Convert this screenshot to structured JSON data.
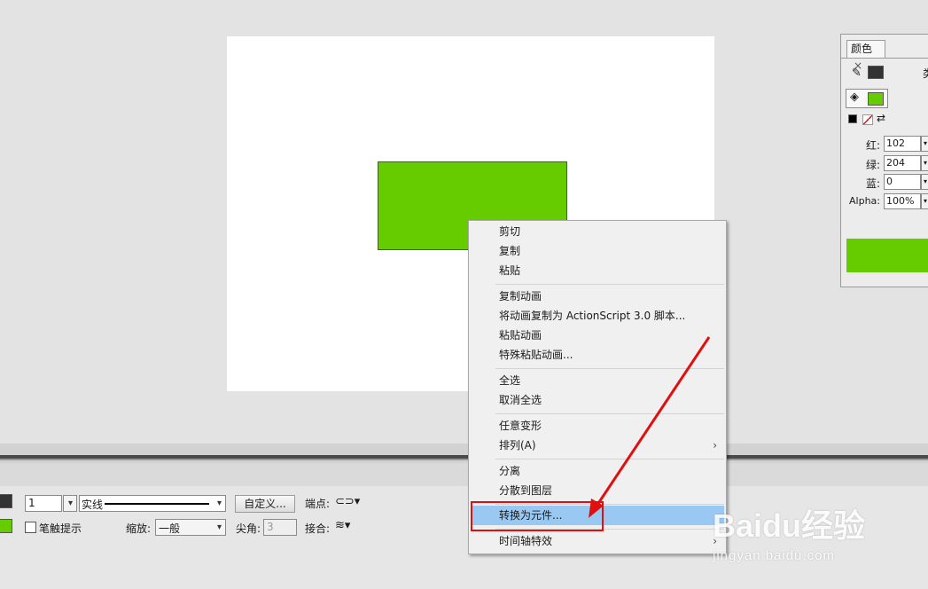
{
  "colors": {
    "shape_fill": "#66cc00",
    "menu_highlight": "#99c9f3",
    "annotation_red": "#e01010"
  },
  "context_menu": {
    "items": [
      {
        "label": "剪切"
      },
      {
        "label": "复制"
      },
      {
        "label": "粘贴"
      },
      {
        "label": "复制动画"
      },
      {
        "label": "将动画复制为 ActionScript 3.0 脚本..."
      },
      {
        "label": "粘贴动画"
      },
      {
        "label": "特殊粘贴动画..."
      },
      {
        "label": "全选"
      },
      {
        "label": "取消全选"
      },
      {
        "label": "任意变形"
      },
      {
        "label": "排列(A)",
        "submenu": "›"
      },
      {
        "label": "分离"
      },
      {
        "label": "分散到图层"
      },
      {
        "label": "转换为元件...",
        "highlighted": true
      },
      {
        "label": "时间轴特效",
        "submenu": "›"
      }
    ]
  },
  "color_panel": {
    "tab_label": "颜色",
    "close_glyph": "×",
    "type_label_partial": "类",
    "red_label": "红:",
    "red_value": "102",
    "green_label": "绿:",
    "green_value": "204",
    "blue_label": "蓝:",
    "blue_value": "0",
    "alpha_label": "Alpha:",
    "alpha_value": "100%"
  },
  "properties": {
    "stroke_height": "1",
    "stroke_style": "实线",
    "custom_button": "自定义...",
    "cap_label": "端点:",
    "stroke_hint_label": "笔触提示",
    "scale_label": "缩放:",
    "scale_value": "一般",
    "miter_label": "尖角:",
    "miter_value": "3",
    "join_label": "接合:"
  },
  "watermark": {
    "brand": "Baidu经验",
    "url": "jingyan.baidu.com"
  }
}
